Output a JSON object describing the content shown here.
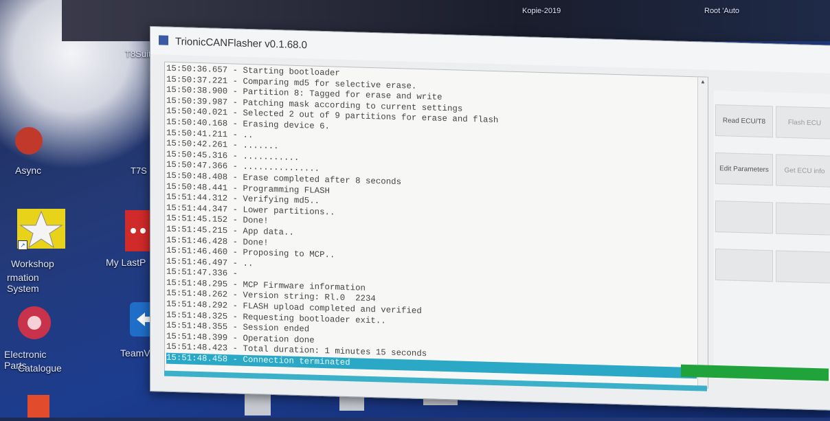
{
  "window": {
    "title": "TrionicCANFlasher v0.1.68.0"
  },
  "log": [
    "15:50:36.657 - Starting bootloader",
    "15:50:37.221 - Comparing md5 for selective erase.",
    "15:50:38.900 - Partition 8: Tagged for erase and write",
    "15:50:39.987 - Patching mask according to current settings",
    "15:50:40.021 - Selected 2 out of 9 partitions for erase and flash",
    "15:50:40.168 - Erasing device 6.",
    "15:50:41.211 - ..",
    "15:50:42.261 - .......",
    "15:50:45.316 - ...........",
    "15:50:47.366 - ...............",
    "15:50:48.408 - Erase completed after 8 seconds",
    "15:50:48.441 - Programming FLASH",
    "15:51:44.312 - Verifying md5..",
    "15:51:44.347 - Lower partitions..",
    "15:51:45.152 - Done!",
    "15:51:45.215 - App data..",
    "15:51:46.428 - Done!",
    "15:51:46.460 - Proposing to MCP..",
    "15:51:46.497 - ..",
    "15:51:47.336 - ",
    "15:51:48.295 - MCP Firmware information",
    "15:51:48.262 - Version string: Rl.0  2234",
    "15:51:48.292 - FLASH upload completed and verified",
    "15:51:48.325 - Requesting bootloader exit..",
    "15:51:48.355 - Session ended",
    "15:51:48.399 - Operation done",
    "15:51:48.423 - Total duration: 1 minutes 15 seconds",
    "15:51:48.458 - Connection terminated"
  ],
  "right_panel": {
    "buttons": [
      "Read ECU/T8",
      "Flash ECU",
      "Edit Parameters",
      "Get ECU info"
    ]
  },
  "desktop": {
    "top_label_1": "Kopie-2019",
    "top_label_2": "Root 'Auto",
    "icons": [
      "T8Suit",
      "Async",
      "T7S",
      "Workshop",
      "rmation System",
      "My LastP",
      "Electronic Parts",
      "Catalogue",
      "TeamVi"
    ]
  },
  "colors": {
    "selection": "#2aa8c6",
    "progress": "#1fa33a"
  }
}
